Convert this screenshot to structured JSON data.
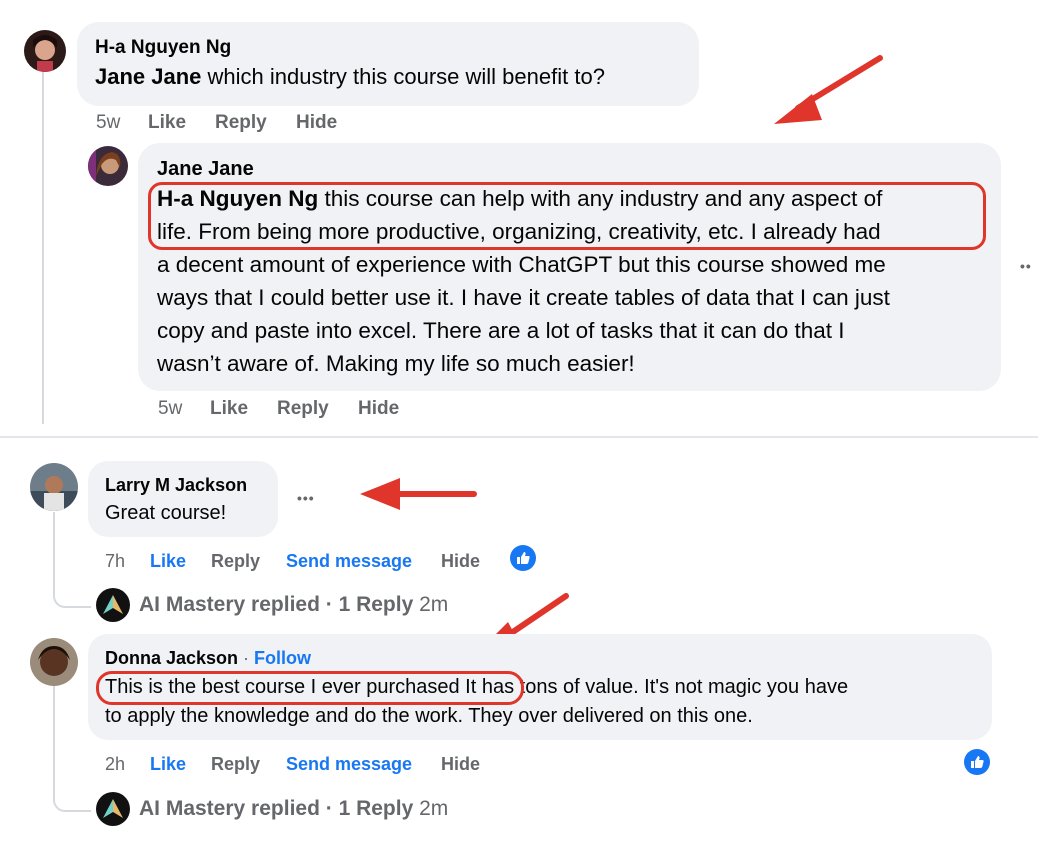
{
  "comment1": {
    "author": "H-a Nguyen Ng",
    "mention": "Jane Jane",
    "text": " which industry this course will benefit to?",
    "time": "5w",
    "like": "Like",
    "reply": "Reply",
    "hide": "Hide"
  },
  "reply1": {
    "author": "Jane Jane",
    "mention": "H-a Nguyen Ng",
    "lines": [
      " this course can help with any industry and any aspect of",
      "life. From being more productive, organizing, creativity, etc. I already had",
      "a decent amount of experience with ChatGPT but this course showed me",
      "ways that I could better use it. I have it create tables of data that I can just",
      "copy and paste into excel. There are a lot of tasks that it can do that I",
      "wasn’t aware of. Making my life so much easier!"
    ],
    "more": "••",
    "time": "5w",
    "like": "Like",
    "reply": "Reply",
    "hide": "Hide"
  },
  "comment2": {
    "author": "Larry M Jackson",
    "text": "Great course!",
    "more": "•••",
    "time": "7h",
    "like": "Like",
    "reply": "Reply",
    "send_message": "Send message",
    "hide": "Hide",
    "replied": {
      "page": "AI Mastery",
      "summary": " replied · 1 Reply",
      "time": "2m"
    }
  },
  "comment3": {
    "author": "Donna Jackson",
    "follow_sep": " · ",
    "follow": "Follow",
    "line1_highlight": "This is the best course I ever purchased",
    "line1_rest": " It has tons of value. It's not magic you have",
    "line2": "to apply the knowledge and do the work. They over delivered on this one.",
    "time": "2h",
    "like": "Like",
    "reply": "Reply",
    "send_message": "Send message",
    "hide": "Hide",
    "replied": {
      "page": "AI Mastery",
      "summary": " replied · 1 Reply",
      "time": "2m"
    }
  },
  "colors": {
    "annotation_red": "#e0352b",
    "facebook_blue": "#1877f2",
    "bubble_gray": "#f0f2f5",
    "meta_gray": "#65676b"
  },
  "icons": {
    "annotation": "red-arrow-icon",
    "reaction": "thumbs-up-icon",
    "page_logo": "ai-mastery-logo-icon"
  }
}
